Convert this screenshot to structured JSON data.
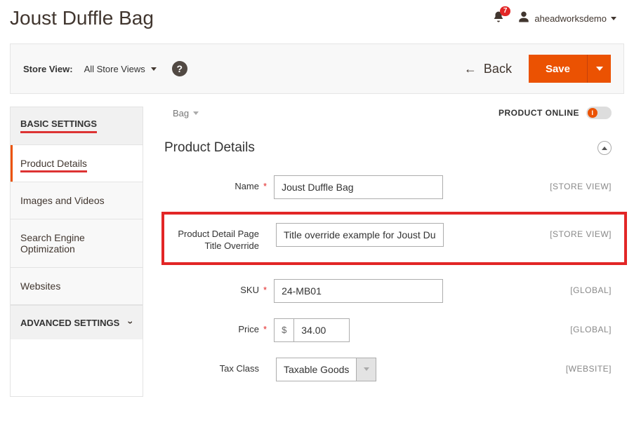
{
  "header": {
    "title": "Joust Duffle Bag",
    "notifications": "7",
    "username": "aheadworksdemo"
  },
  "toolbar": {
    "store_view_label": "Store View:",
    "store_view_value": "All Store Views",
    "back_label": "Back",
    "save_label": "Save"
  },
  "sidebar": {
    "basic_label": "BASIC SETTINGS",
    "items": [
      "Product Details",
      "Images and Videos",
      "Search Engine Optimization",
      "Websites"
    ],
    "advanced_label": "ADVANCED SETTINGS"
  },
  "main": {
    "breadcrumb": "Bag",
    "online_label": "PRODUCT ONLINE",
    "section_title": "Product Details",
    "scopes": {
      "store_view": "[STORE VIEW]",
      "global": "[GLOBAL]",
      "website": "[WEBSITE]"
    },
    "fields": {
      "name": {
        "label": "Name",
        "value": "Joust Duffle Bag"
      },
      "override": {
        "label": "Product Detail Page Title Override",
        "value": "Title override example for Joust Duffle Bag"
      },
      "sku": {
        "label": "SKU",
        "value": "24-MB01"
      },
      "price": {
        "label": "Price",
        "currency": "$",
        "value": "34.00"
      },
      "tax": {
        "label": "Tax Class",
        "value": "Taxable Goods"
      }
    }
  }
}
